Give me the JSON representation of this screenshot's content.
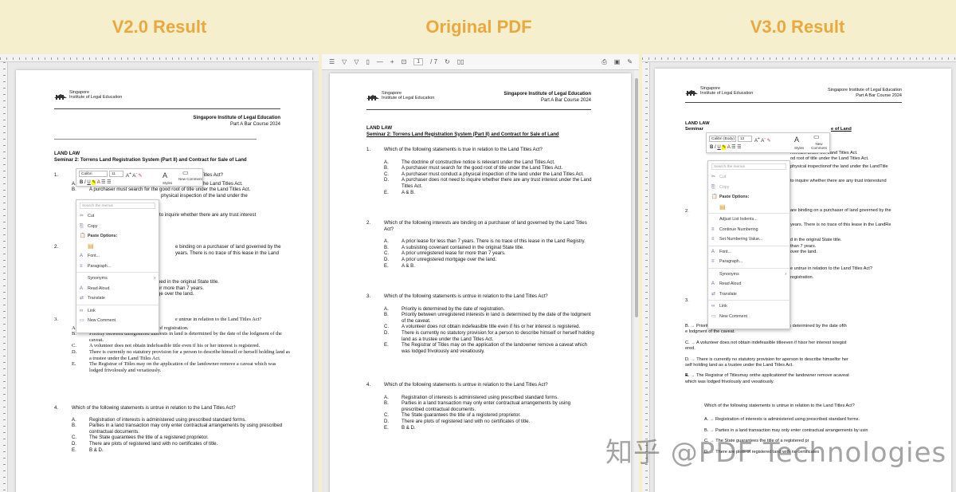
{
  "headers": {
    "v2": "V2.0 Result",
    "orig": "Original PDF",
    "v3": "V3.0 Result"
  },
  "doc": {
    "logo_line1": "Singapore",
    "logo_line2": "Institute of Legal Education",
    "institute": "Singapore Institute of Legal Education",
    "course": "Part A Bar Course 2024",
    "section": "LAND LAW",
    "seminar": "Seminar 2: Torrens Land Registration System (Part II) and Contract for Sale of Land",
    "q1": {
      "num": "1.",
      "text": "Which of the following statements is true in relation to the Land Titles Act?",
      "options": [
        [
          "A.",
          "The doctrine of constructive notice is relevant under the Land Titles Act."
        ],
        [
          "B.",
          "A purchaser must search for the good root of title under the Land Titles Act."
        ],
        [
          "C.",
          "A purchaser must conduct a physical inspection of the land under the Land Titles Act."
        ],
        [
          "D.",
          "A purchaser does not need to inquire whether there are any trust interest under the Land Titles Act."
        ],
        [
          "E.",
          "A & B."
        ]
      ]
    },
    "q2": {
      "num": "2.",
      "text": "Which of the following interests are binding on a purchaser of land governed by the Land Titles Act?",
      "options": [
        [
          "A.",
          "A prior lease for less than 7 years. There is no trace of this lease in the Land Registry."
        ],
        [
          "B.",
          "A subsisting covenant contained in the original State title."
        ],
        [
          "C.",
          "A prior unregistered lease for more than 7 years."
        ],
        [
          "D.",
          "A prior unregistered mortgage over the land."
        ],
        [
          "E.",
          "A & B."
        ]
      ]
    },
    "q3": {
      "num": "3.",
      "text": "Which of the following statements is untrue in relation to the Land Titles Act?",
      "options": [
        [
          "A.",
          "Priority is determined by the date of registration."
        ],
        [
          "B.",
          "Priority between unregistered interests in land is determined by the date of the lodgment of the caveat."
        ],
        [
          "C.",
          "A volunteer does not obtain indefeasible title even if his or her interest is registered."
        ],
        [
          "D.",
          "There is currently no statutory provision for a person to describe himself or herself holding land as a trustee under the Land Titles Act."
        ],
        [
          "E.",
          "The Registrar of Titles may on the application of the landowner remove a caveat which was lodged frivolously and vexatiously."
        ]
      ]
    },
    "q4": {
      "num": "4.",
      "text": "Which of the following statements is untrue in relation to the Land Titles Act?",
      "options": [
        [
          "A.",
          "Registration of interests is administered using prescribed standard forms."
        ],
        [
          "B.",
          "Parties in a land transaction may only enter contractual arrangements by using prescribed contractual documents."
        ],
        [
          "C.",
          "The State guarantees the title of a registered proprietor."
        ],
        [
          "D.",
          "There are plots of registered land with no certificates of title."
        ],
        [
          "E.",
          "B & D."
        ]
      ]
    }
  },
  "v2_menu": {
    "search": "Search the menus",
    "font": "Calibri",
    "size": "11",
    "styles": "Styles",
    "new_comment": "New Comment",
    "items": [
      "Cut",
      "Copy",
      "Paste Options:",
      "Font...",
      "Paragraph...",
      "Synonyms",
      "Read Aloud",
      "Translate",
      "Link",
      "New Comment"
    ]
  },
  "v3_menu": {
    "search": "Search the menus",
    "font": "Calibri (Body)",
    "size": "12",
    "styles": "Styles",
    "new_comment": "New Comment",
    "items": [
      "Cut",
      "Copy",
      "Paste Options:",
      "Adjust List Indents...",
      "Continue Numbering",
      "Set Numbering Value...",
      "Font...",
      "Paragraph...",
      "Synonyms",
      "Read Aloud",
      "Translate",
      "Link",
      "New Comment"
    ]
  },
  "pdf_toolbar": {
    "page": "1",
    "total": "/ 7"
  },
  "v3_partial": {
    "q1c": "physical inspectionof the land under the LandTitle",
    "q1d": "to inquire whether there are any trust interestund",
    "q2a": "years. There is no trace of this lease in the LandRe",
    "q3b": "Priority between unregistered interests in land is determined by the date ofth",
    "q3b2": "e lodgment of the caveat.",
    "q3c": "A volunteer does not obtain indefeasible titleeven if hisor her interest isregist",
    "q3c2": "ered.",
    "q3d": "There is currently no statutory provision for aperson to describe himselfor her",
    "q3d2": "self holding land as a trustee under the Land Titles Act.",
    "q3e": "The Registrar of Titlesmay onthe applicationof the landowner remove acaveat",
    "q3e2": "which was lodged frivolously and vexatiously.",
    "q4a": "Registration of interests is administered using prescribed standard forms.",
    "q4b": "Parties in a land transaction may only enter contractual arrangements by usin",
    "q4c": "The State guarantees the title of a registered pr",
    "q4d": "There are plots of registered land with no certificates"
  },
  "watermark": "知乎 @PDF Technologies",
  "colors": {
    "header": "#e9a93e",
    "background": "#f6efcd",
    "spellcheck": "#d33"
  }
}
